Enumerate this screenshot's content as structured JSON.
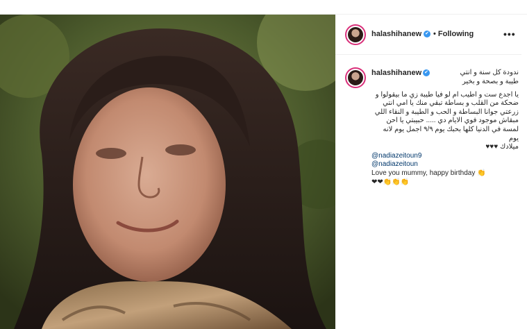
{
  "post": {
    "header": {
      "username": "halashihanew",
      "verified_mark": "✔",
      "separator": "•",
      "follow_status": "Following",
      "more_icon": "•••"
    },
    "caption": {
      "username": "halashihanew",
      "verified_mark": "✔",
      "arabic_line_1": "ندودة كل سنة و انتي",
      "arabic_line_2": "طيبة و بصحة و بخير",
      "arabic_body": "يا اجدع ست و اطيب ام لو فيا طيبة زي ما بيقولوا و ضحكة من القلب و بساطة تبقي منك يا امي انتي زرعتي جوانا البساطة و الحب و الطيبة و النقاء اللي مبقاش موجود فوي الايام دي ..... حبيبتي يا احن لمسة في الدنيا كلها بحبك يوم ٩/٩ اجمل يوم لانه يوم",
      "arabic_last": "ميلادك ♥♥♥",
      "mention_1": "@nadiazeitoun9",
      "mention_2": "@nadiazeitoun",
      "english_line": "Love you mummy, happy birthday 👏",
      "emoji_line": "❤❤👏👏👏"
    }
  }
}
